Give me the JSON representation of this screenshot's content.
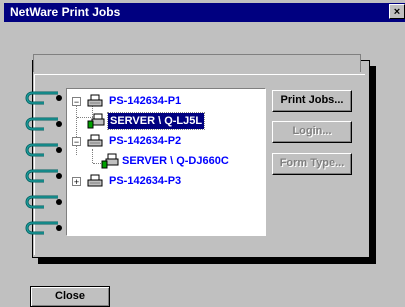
{
  "window": {
    "title": "NetWare Print Jobs",
    "close_glyph": "×"
  },
  "tree": {
    "nodes": [
      {
        "label": "PS-142634-P1",
        "expander": "−",
        "icon": "printer-icon"
      },
      {
        "label": "SERVER \\ Q-LJ5L",
        "icon": "print-queue-icon",
        "selected": true
      },
      {
        "label": "PS-142634-P2",
        "expander": "−",
        "icon": "printer-icon"
      },
      {
        "label": "SERVER \\ Q-DJ660C",
        "icon": "print-queue-icon"
      },
      {
        "label": "PS-142634-P3",
        "expander": "+",
        "icon": "printer-icon"
      }
    ]
  },
  "buttons": {
    "print_jobs": "Print Jobs...",
    "login": "Login...",
    "form_type": "Form Type...",
    "close": "Close"
  },
  "colors": {
    "titlebar": "#000080",
    "tree_text": "#0000ff",
    "ring": "#008080"
  }
}
